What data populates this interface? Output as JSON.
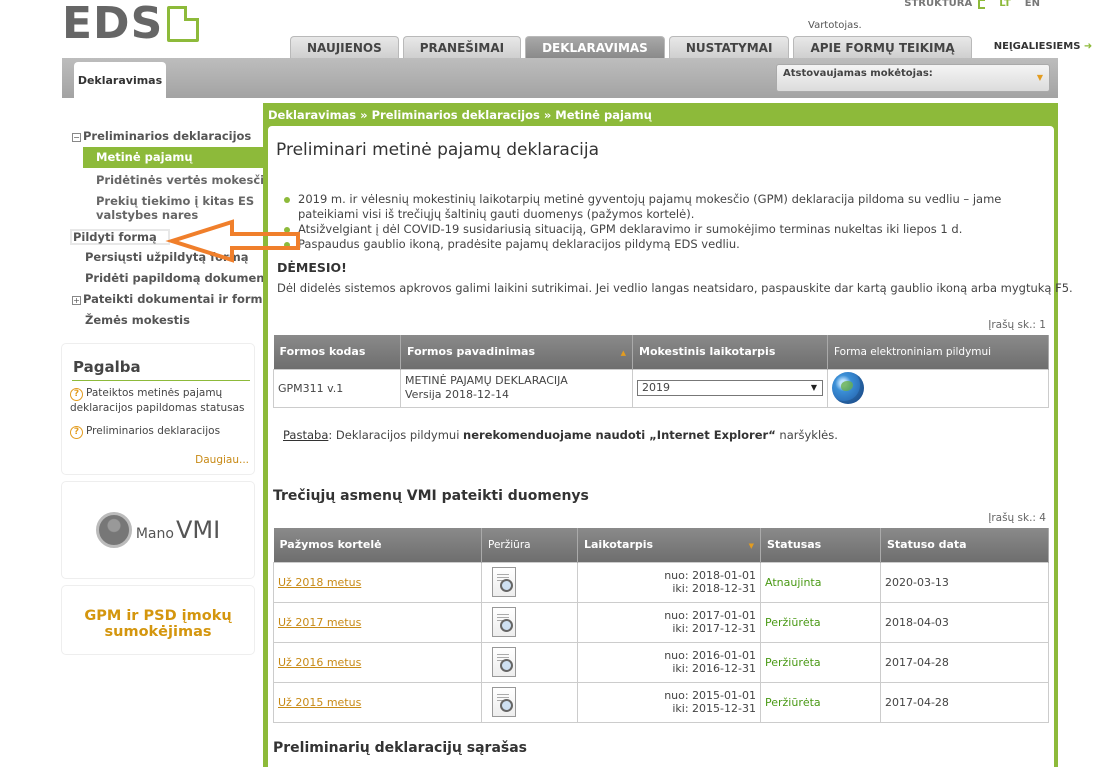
{
  "header": {
    "logo_text": "EDS",
    "top_links": {
      "structure": "STRUKTŪRA",
      "lang_lt": "LT",
      "lang_en": "EN"
    },
    "user_label": "Vartotojas.",
    "tabs": [
      "NAUJIENOS",
      "PRANEŠIMAI",
      "DEKLARAVIMAS",
      "NUSTATYMAI",
      "APIE FORMŲ TEIKIMĄ"
    ],
    "active_tab": "DEKLARAVIMAS",
    "disabled_link": "NEĮGALIESIEMS",
    "subtab": "Deklaravimas",
    "payer_label": "Atstovaujamas mokėtojas:"
  },
  "sidebar": {
    "nav": [
      {
        "label": "Preliminarios deklaracijos",
        "level": 0,
        "expandable": true
      },
      {
        "label": "Metinė pajamų",
        "level": 1,
        "active": true
      },
      {
        "label": "Pridėtinės vertės mokesčio",
        "level": 1
      },
      {
        "label": "Prekių tiekimo į kitas ES",
        "level": 1
      },
      {
        "label": "valstybes nares",
        "level": 1
      },
      {
        "label": "Pildyti formą",
        "level": 0
      },
      {
        "label": "Persiųsti užpildytą formą",
        "level": 0
      },
      {
        "label": "Pridėti papildomą dokumentą",
        "level": 0
      },
      {
        "label": "Pateikti dokumentai ir formos",
        "level": 0,
        "expandable": true
      },
      {
        "label": "Žemės mokestis",
        "level": 0
      }
    ],
    "help": {
      "title": "Pagalba",
      "items": [
        "Pateiktos metinės pajamų",
        "deklaracijos papildomas statusas",
        "Preliminarios deklaracijos"
      ],
      "more": "Daugiau..."
    },
    "mano_vmi": {
      "prefix": "Mano",
      "brand": "VMI"
    },
    "gpm_box": {
      "line1": "GPM ir PSD įmokų",
      "line2": "sumokėjimas"
    }
  },
  "main": {
    "breadcrumb": "Deklaravimas »  Preliminarios deklaracijos  » Metinė pajamų",
    "title": "Preliminari metinė pajamų deklaracija",
    "bullets": [
      "2019 m. ir vėlesnių mokestinių laikotarpių metinė gyventojų pajamų mokesčio (GPM) deklaracija pildoma su vedliu – jame pateikiami visi iš trečiųjų šaltinių gauti duomenys (pažymos kortelė).",
      "Atsižvelgiant į dėl COVID-19 susidariusią situaciją, GPM deklaravimo ir sumokėjimo terminas nukeltas iki liepos 1 d.",
      "Paspaudus gaublio ikoną, pradėsite pajamų deklaracijos pildymą EDS vedliu."
    ],
    "attention_title": "DĖMESIO!",
    "attention_text": "Dėl didelės sistemos apkrovos galimi laikini sutrikimai. Jei vedlio langas neatsidaro, paspauskite dar kartą gaublio ikoną arba mygtuką F5.",
    "forms_count": "Įrašų sk.: 1",
    "forms_table": {
      "headers": [
        "Formos kodas",
        "Formos pavadinimas",
        "Mokestinis laikotarpis",
        "Forma elektroniniam pildymui"
      ],
      "row": {
        "code": "GPM311 v.1",
        "name": "METINĖ PAJAMŲ DEKLARACIJA",
        "version": "Versija 2018-12-14",
        "period": "2019"
      }
    },
    "note": {
      "label": "Pastaba",
      "text1": ": Deklaracijos pildymui ",
      "bold": "nerekomenduojame naudoti „Internet Explorer“",
      "text2": " naršyklės."
    },
    "third_party_title": "Trečiųjų asmenų VMI pateikti duomenys",
    "third_count": "Įrašų sk.: 4",
    "third_table": {
      "headers": [
        "Pažymos kortelė",
        "Peržiūra",
        "Laikotarpis",
        "Statusas",
        "Statuso data"
      ],
      "rows": [
        {
          "card": "Už 2018 metus",
          "from": "nuo: 2018-01-01",
          "to": "iki: 2018-12-31",
          "status": "Atnaujinta",
          "date": "2020-03-13"
        },
        {
          "card": "Už 2017 metus",
          "from": "nuo: 2017-01-01",
          "to": "iki: 2017-12-31",
          "status": "Peržiūrėta",
          "date": "2018-04-03"
        },
        {
          "card": "Už 2016 metus",
          "from": "nuo: 2016-01-01",
          "to": "iki: 2016-12-31",
          "status": "Peržiūrėta",
          "date": "2017-04-28"
        },
        {
          "card": "Už 2015 metus",
          "from": "nuo: 2015-01-01",
          "to": "iki: 2015-12-31",
          "status": "Peržiūrėta",
          "date": "2017-04-28"
        }
      ]
    },
    "prelim_list_title": "Preliminarių deklaracijų sąrašas"
  },
  "colors": {
    "accent_green": "#8dba3a",
    "link_orange": "#c88a16",
    "annotation_orange": "#f07f2b"
  }
}
